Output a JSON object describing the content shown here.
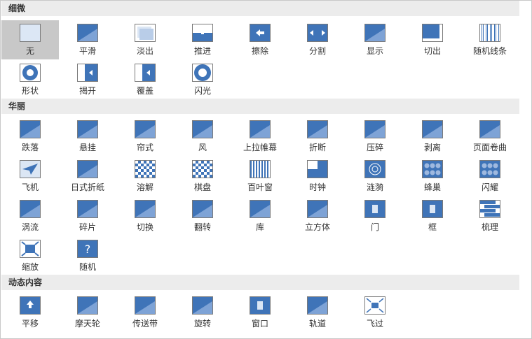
{
  "sections": [
    {
      "title": "细微",
      "items": [
        {
          "label": "无",
          "icon": "none-icon",
          "selected": true
        },
        {
          "label": "平滑",
          "icon": "morph-icon"
        },
        {
          "label": "淡出",
          "icon": "fade-icon"
        },
        {
          "label": "推进",
          "icon": "push-icon"
        },
        {
          "label": "擦除",
          "icon": "wipe-icon"
        },
        {
          "label": "分割",
          "icon": "split-icon"
        },
        {
          "label": "显示",
          "icon": "reveal-icon"
        },
        {
          "label": "切出",
          "icon": "cut-icon"
        },
        {
          "label": "随机线条",
          "icon": "random-bars-icon"
        },
        {
          "label": "形状",
          "icon": "shape-icon"
        },
        {
          "label": "揭开",
          "icon": "uncover-icon"
        },
        {
          "label": "覆盖",
          "icon": "cover-icon"
        },
        {
          "label": "闪光",
          "icon": "flash-icon"
        }
      ]
    },
    {
      "title": "华丽",
      "items": [
        {
          "label": "跌落",
          "icon": "fall-over-icon"
        },
        {
          "label": "悬挂",
          "icon": "drape-icon"
        },
        {
          "label": "帘式",
          "icon": "curtains-icon"
        },
        {
          "label": "风",
          "icon": "wind-icon"
        },
        {
          "label": "上拉帷幕",
          "icon": "prestige-icon"
        },
        {
          "label": "折断",
          "icon": "fracture-icon"
        },
        {
          "label": "压碎",
          "icon": "crush-icon"
        },
        {
          "label": "剥离",
          "icon": "peel-off-icon"
        },
        {
          "label": "页面卷曲",
          "icon": "page-curl-icon"
        },
        {
          "label": "飞机",
          "icon": "airplane-icon"
        },
        {
          "label": "日式折纸",
          "icon": "origami-icon"
        },
        {
          "label": "溶解",
          "icon": "dissolve-icon"
        },
        {
          "label": "棋盘",
          "icon": "checkerboard-icon"
        },
        {
          "label": "百叶窗",
          "icon": "blinds-icon"
        },
        {
          "label": "时钟",
          "icon": "clock-icon"
        },
        {
          "label": "涟漪",
          "icon": "ripple-icon"
        },
        {
          "label": "蜂巢",
          "icon": "honeycomb-icon"
        },
        {
          "label": "闪耀",
          "icon": "glitter-icon"
        },
        {
          "label": "涡流",
          "icon": "vortex-icon"
        },
        {
          "label": "碎片",
          "icon": "shred-icon"
        },
        {
          "label": "切换",
          "icon": "switch-icon"
        },
        {
          "label": "翻转",
          "icon": "flip-icon"
        },
        {
          "label": "库",
          "icon": "gallery-icon"
        },
        {
          "label": "立方体",
          "icon": "cube-icon"
        },
        {
          "label": "门",
          "icon": "doors-icon"
        },
        {
          "label": "框",
          "icon": "box-icon"
        },
        {
          "label": "梳理",
          "icon": "comb-icon"
        },
        {
          "label": "缩放",
          "icon": "zoom-icon"
        },
        {
          "label": "随机",
          "icon": "random-icon"
        }
      ]
    },
    {
      "title": "动态内容",
      "items": [
        {
          "label": "平移",
          "icon": "pan-icon"
        },
        {
          "label": "摩天轮",
          "icon": "ferris-wheel-icon"
        },
        {
          "label": "传送带",
          "icon": "conveyor-icon"
        },
        {
          "label": "旋转",
          "icon": "rotate-icon"
        },
        {
          "label": "窗口",
          "icon": "window-icon"
        },
        {
          "label": "轨道",
          "icon": "orbit-icon"
        },
        {
          "label": "飞过",
          "icon": "fly-through-icon"
        }
      ]
    }
  ],
  "colors": {
    "header_bg": "#ececec",
    "selected_bg": "#c8c8c8",
    "icon_blue": "#3f74b8",
    "icon_light": "#dbe6f4"
  }
}
